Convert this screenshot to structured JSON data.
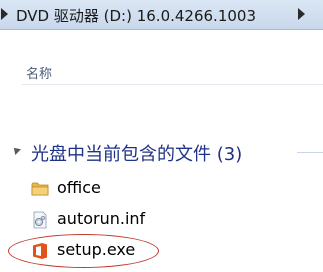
{
  "address_bar": {
    "path": "DVD 驱动器 (D:) 16.0.4266.1003"
  },
  "columns": {
    "name_header": "名称"
  },
  "group": {
    "title": "光盘中当前包含的文件 (3)"
  },
  "files": [
    {
      "name": "office",
      "icon": "folder-icon"
    },
    {
      "name": "autorun.inf",
      "icon": "settings-file-icon"
    },
    {
      "name": "setup.exe",
      "icon": "office-setup-icon"
    }
  ],
  "colors": {
    "group_title": "#1e3287",
    "highlight": "#c0392b",
    "office_orange": "#e0531b",
    "folder_yellow": "#e8b84a"
  }
}
